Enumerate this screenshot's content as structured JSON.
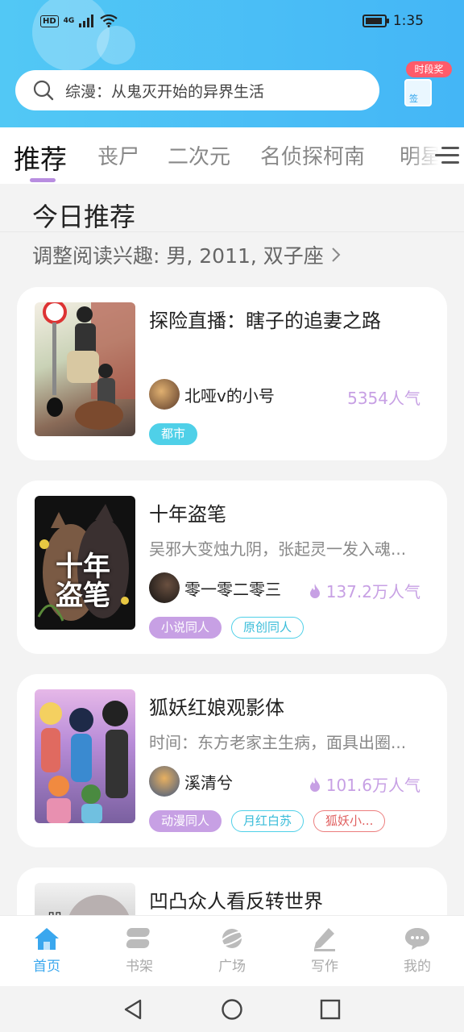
{
  "status_bar": {
    "network": "HD",
    "signal_label": "4G",
    "time": "1:35"
  },
  "search": {
    "placeholder": "综漫：从鬼灭开始的异界生活"
  },
  "reward": {
    "badge": "时段奖",
    "sign": "签"
  },
  "tabs": [
    {
      "label": "推荐",
      "active": true
    },
    {
      "label": "丧尸"
    },
    {
      "label": "二次元"
    },
    {
      "label": "名侦探柯南"
    },
    {
      "label": "明星"
    }
  ],
  "section": {
    "title": "今日推荐",
    "subtitle": "调整阅读兴趣: 男, 2011, 双子座"
  },
  "books": [
    {
      "title": "探险直播：瞎子的追妻之路",
      "description": "",
      "author": "北哑v的小号",
      "popularity": "5354人气",
      "tags": [
        {
          "label": "都市",
          "style": "filled-cyan"
        }
      ]
    },
    {
      "title": "十年盗笔",
      "description": "吴邪大变烛九阴，张起灵一发入魂...",
      "author": "零一零二零三",
      "popularity": "137.2万人气",
      "cover_text": "十年盗笔",
      "tags": [
        {
          "label": "小说同人",
          "style": "filled-purple"
        },
        {
          "label": "原创同人",
          "style": "outline-cyan"
        }
      ]
    },
    {
      "title": "狐妖红娘观影体",
      "description": "时间：东方老家主生病，面具出圈...",
      "author": "溪清兮",
      "popularity": "101.6万人气",
      "tags": [
        {
          "label": "动漫同人",
          "style": "filled-purple"
        },
        {
          "label": "月红白苏",
          "style": "outline-cyan"
        },
        {
          "label": "狐妖小...",
          "style": "outline-red"
        }
      ]
    },
    {
      "title": "凹凸众人看反转世界",
      "cover_text": "凹"
    }
  ],
  "bottom_nav": [
    {
      "label": "首页",
      "icon": "home-icon",
      "active": true
    },
    {
      "label": "书架",
      "icon": "bookshelf-icon"
    },
    {
      "label": "广场",
      "icon": "planet-icon"
    },
    {
      "label": "写作",
      "icon": "pen-icon"
    },
    {
      "label": "我的",
      "icon": "chat-bubble-icon"
    }
  ],
  "colors": {
    "header": "#4fc3f7",
    "accent_purple": "#c7a0e4",
    "accent_cyan": "#4fd0e8",
    "nav_active": "#3aa7ee"
  }
}
